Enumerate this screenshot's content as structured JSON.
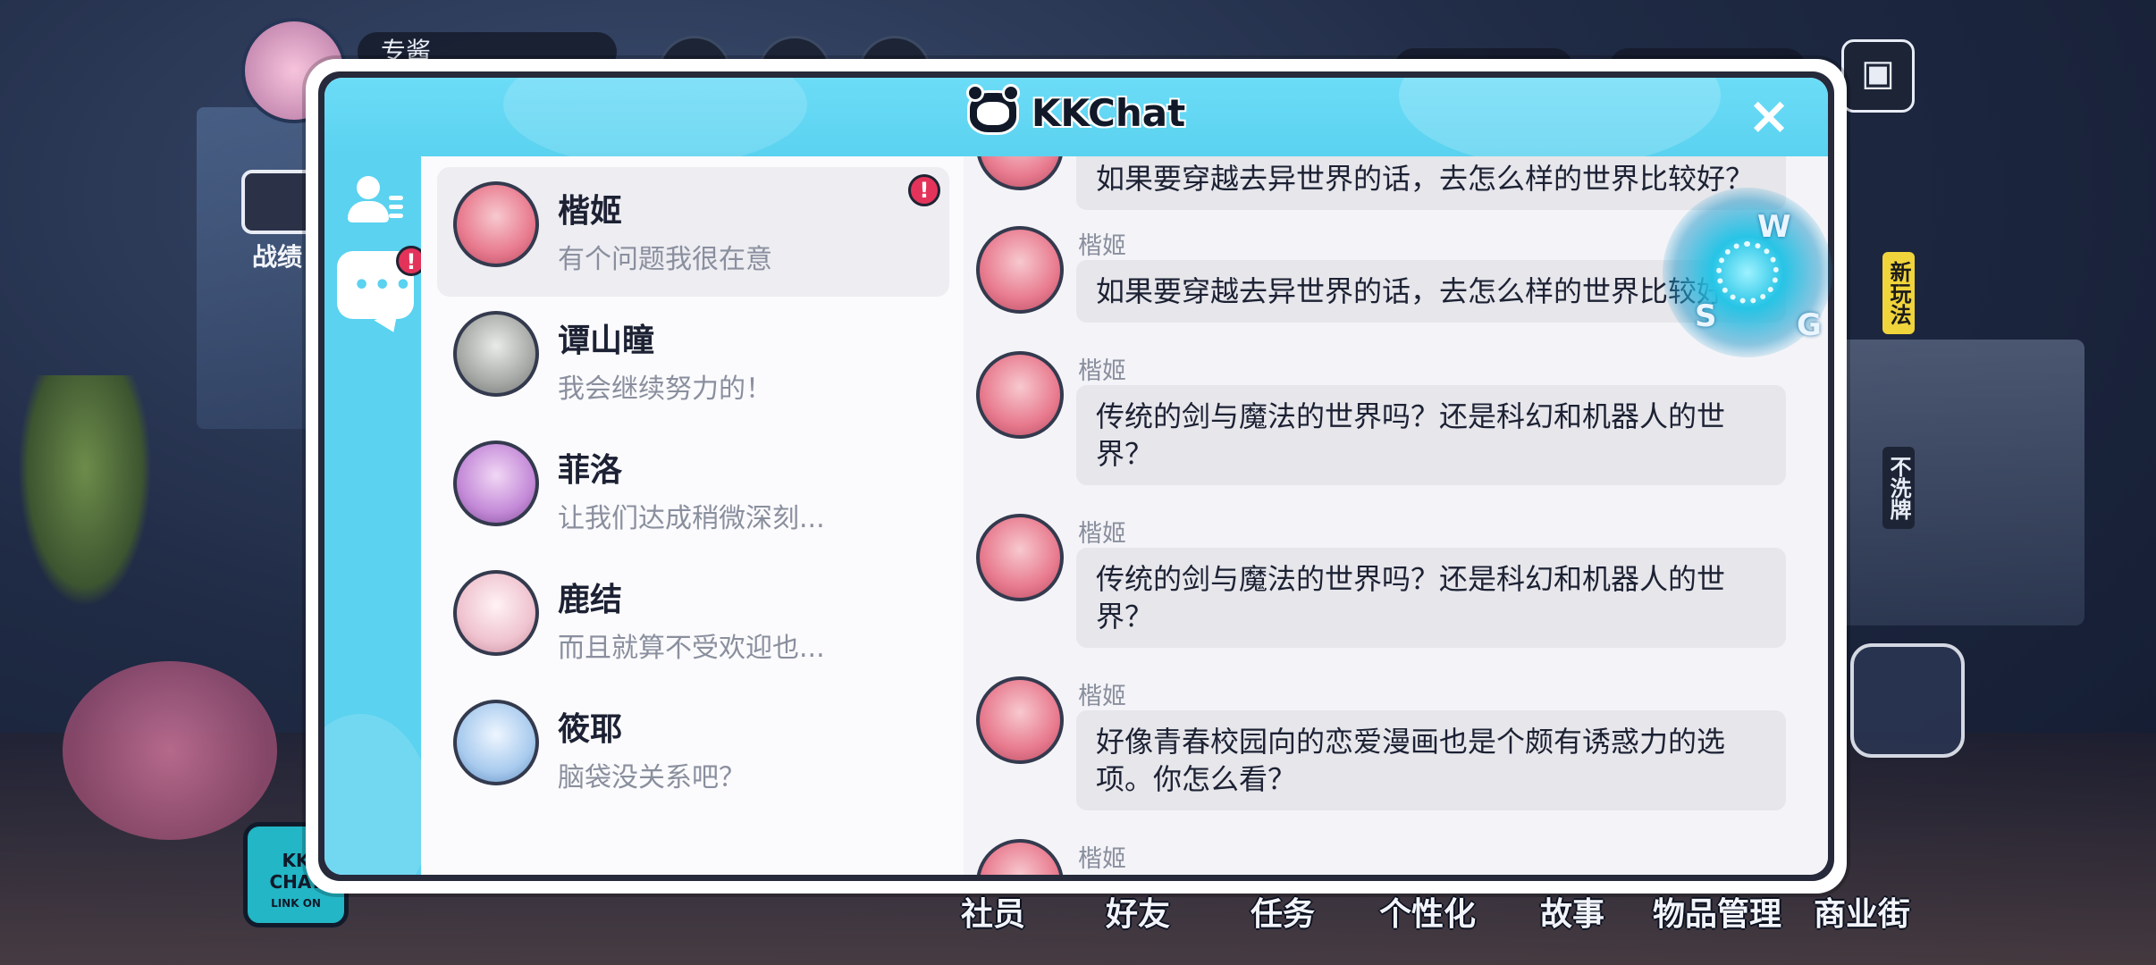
{
  "app": {
    "title": "KKChat"
  },
  "hud": {
    "player_name": "专酱",
    "left_button_label": "战绩",
    "side_tags": [
      "新玩法",
      "不洗牌"
    ],
    "kkchat_button": [
      "KK",
      "CHAT",
      "LINK ON"
    ],
    "bottom_nav": [
      "社员",
      "好友",
      "任务",
      "个性化",
      "故事",
      "物品管理",
      "商业街"
    ]
  },
  "sidebar": {
    "chat_tab_badge": "!"
  },
  "contacts": [
    {
      "name": "楷姬",
      "preview": "有个问题我很在意",
      "badge": "!",
      "avatar_color": "#e87a8e"
    },
    {
      "name": "谭山瞳",
      "preview": "我会继续努力的！",
      "avatar_color": "#a7a9a6"
    },
    {
      "name": "菲洛",
      "preview": "让我们达成稍微深刻...",
      "avatar_color": "#c48ad8"
    },
    {
      "name": "鹿结",
      "preview": "而且就算不受欢迎也...",
      "avatar_color": "#efc3cf"
    },
    {
      "name": "筱耶",
      "preview": "脑袋没关系吧？",
      "avatar_color": "#a9cbee"
    }
  ],
  "chat": {
    "messages": [
      {
        "sender": "",
        "text": "如果要穿越去异世界的话，去怎么样的世界比较好？"
      },
      {
        "sender": "楷姬",
        "text": "如果要穿越去异世界的话，去怎么样的世界比较好？"
      },
      {
        "sender": "楷姬",
        "text": "传统的剑与魔法的世界吗？还是科幻和机器人的世界？"
      },
      {
        "sender": "楷姬",
        "text": "传统的剑与魔法的世界吗？还是科幻和机器人的世界？"
      },
      {
        "sender": "楷姬",
        "text": "好像青春校园向的恋爱漫画也是个颇有诱惑力的选项。你怎么看？"
      },
      {
        "sender": "楷姬",
        "text": ""
      }
    ]
  },
  "floating_widget": {
    "letters": [
      "W",
      "S",
      "G"
    ]
  },
  "colors": {
    "header": "#5ad2f0",
    "badge": "#e3335a",
    "bubble": "#e6e6eb"
  }
}
